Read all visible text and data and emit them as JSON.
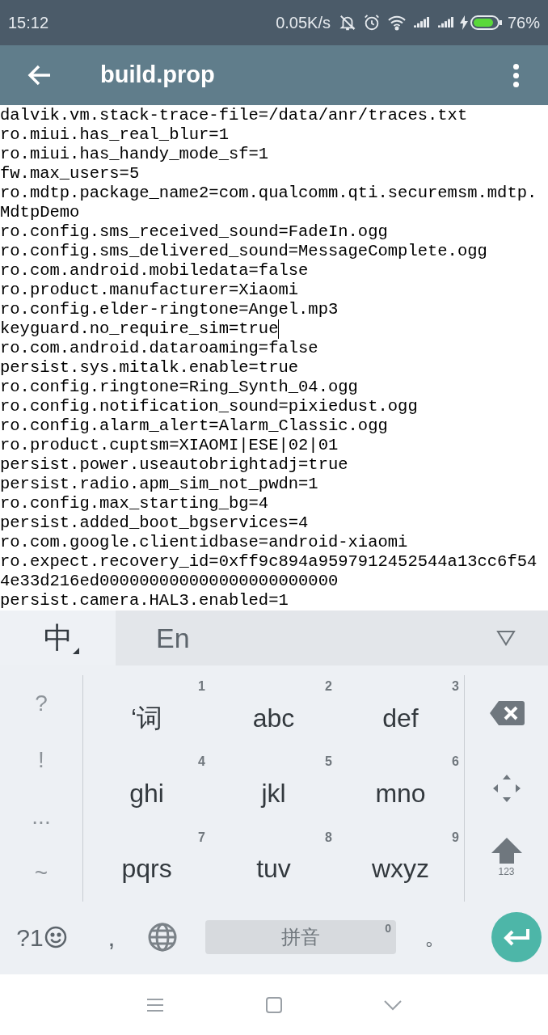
{
  "status_bar": {
    "time": "15:12",
    "net_speed": "0.05K/s",
    "battery_percent": "76%"
  },
  "app_bar": {
    "title": "build.prop"
  },
  "editor": {
    "lines": [
      {
        "text": "dalvik.vm.stack-trace-file=/data/anr/traces.txt",
        "cursor": false
      },
      {
        "text": "ro.miui.has_real_blur=1",
        "cursor": false
      },
      {
        "text": "ro.miui.has_handy_mode_sf=1",
        "cursor": false
      },
      {
        "text": "fw.max_users=5",
        "cursor": false
      },
      {
        "text": "ro.mdtp.package_name2=com.qualcomm.qti.securemsm.mdtp.",
        "cursor": false
      },
      {
        "text": "MdtpDemo",
        "cursor": false
      },
      {
        "text": "ro.config.sms_received_sound=FadeIn.ogg",
        "cursor": false
      },
      {
        "text": "ro.config.sms_delivered_sound=MessageComplete.ogg",
        "cursor": false
      },
      {
        "text": "ro.com.android.mobiledata=false",
        "cursor": false
      },
      {
        "text": "ro.product.manufacturer=Xiaomi",
        "cursor": false
      },
      {
        "text": "ro.config.elder-ringtone=Angel.mp3",
        "cursor": false
      },
      {
        "text": "keyguard.no_require_sim=true",
        "cursor": true
      },
      {
        "text": "ro.com.android.dataroaming=false",
        "cursor": false
      },
      {
        "text": "persist.sys.mitalk.enable=true",
        "cursor": false
      },
      {
        "text": "ro.config.ringtone=Ring_Synth_04.ogg",
        "cursor": false
      },
      {
        "text": "ro.config.notification_sound=pixiedust.ogg",
        "cursor": false
      },
      {
        "text": "ro.config.alarm_alert=Alarm_Classic.ogg",
        "cursor": false
      },
      {
        "text": "ro.product.cuptsm=XIAOMI|ESE|02|01",
        "cursor": false
      },
      {
        "text": "persist.power.useautobrightadj=true",
        "cursor": false
      },
      {
        "text": "persist.radio.apm_sim_not_pwdn=1",
        "cursor": false
      },
      {
        "text": "ro.config.max_starting_bg=4",
        "cursor": false
      },
      {
        "text": "persist.added_boot_bgservices=4",
        "cursor": false
      },
      {
        "text": "ro.com.google.clientidbase=android-xiaomi",
        "cursor": false
      },
      {
        "text": "ro.expect.recovery_id=0xff9c894a9597912452544a13cc6f54",
        "cursor": false
      },
      {
        "text": "4e33d216ed000000000000000000000000",
        "cursor": false
      },
      {
        "text": "persist.camera.HAL3.enabled=1",
        "cursor": false
      }
    ]
  },
  "keyboard": {
    "input_modes": [
      {
        "label": "中",
        "selected": true
      },
      {
        "label": "En",
        "selected": false
      }
    ],
    "symbols": [
      "?",
      "!",
      "...",
      "~"
    ],
    "keys": [
      {
        "label": "‘词",
        "digit": "1"
      },
      {
        "label": "abc",
        "digit": "2"
      },
      {
        "label": "def",
        "digit": "3"
      },
      {
        "label": "ghi",
        "digit": "4"
      },
      {
        "label": "jkl",
        "digit": "5"
      },
      {
        "label": "mno",
        "digit": "6"
      },
      {
        "label": "pqrs",
        "digit": "7"
      },
      {
        "label": "tuv",
        "digit": "8"
      },
      {
        "label": "wxyz",
        "digit": "9"
      }
    ],
    "shift_caption": "123",
    "symbol_key": "?1",
    "comma": ",",
    "space": {
      "label": "拼音",
      "digit": "0"
    },
    "period": "。"
  }
}
